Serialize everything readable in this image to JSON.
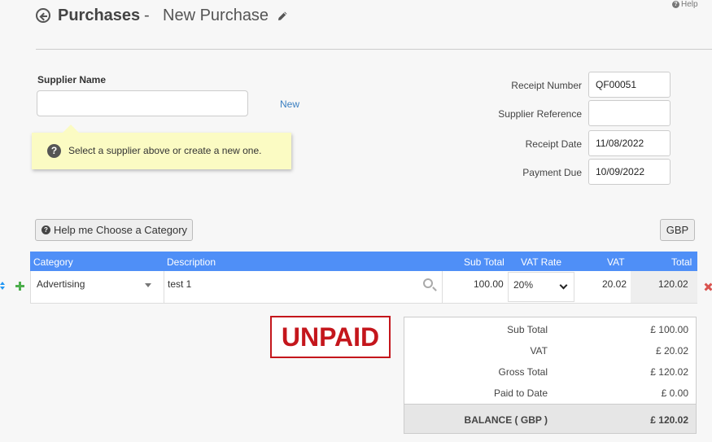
{
  "header": {
    "title": "Purchases",
    "separator": "-",
    "subtitle": "New Purchase",
    "help": "Help"
  },
  "supplier": {
    "label": "Supplier Name",
    "value": "",
    "new_link": "New",
    "tip": "Select a supplier above or create a new one."
  },
  "form": {
    "receipt_number_label": "Receipt Number",
    "receipt_number": "QF00051",
    "supplier_reference_label": "Supplier Reference",
    "supplier_reference": "",
    "receipt_date_label": "Receipt Date",
    "receipt_date": "11/08/2022",
    "payment_due_label": "Payment Due",
    "payment_due": "10/09/2022"
  },
  "buttons": {
    "help_category": "Help me Choose a Category",
    "currency": "GBP"
  },
  "table": {
    "headers": {
      "category": "Category",
      "description": "Description",
      "sub_total": "Sub Total",
      "vat_rate": "VAT Rate",
      "vat": "VAT",
      "total": "Total"
    },
    "rows": [
      {
        "category": "Advertising",
        "description": "test 1",
        "sub_total": "100.00",
        "vat_rate": "20%",
        "vat": "20.02",
        "total": "120.02"
      }
    ]
  },
  "status": "UNPAID",
  "totals": {
    "sub_total_label": "Sub Total",
    "sub_total": "£  100.00",
    "vat_label": "VAT",
    "vat": "£  20.02",
    "gross_total_label": "Gross Total",
    "gross_total": "£  120.02",
    "paid_label": "Paid to Date",
    "paid": "£  0.00",
    "balance_label": "BALANCE ( GBP )",
    "balance": "£  120.02"
  },
  "colors": {
    "table_header": "#4f8ff7",
    "status_red": "#c4161c",
    "link_blue": "#3a7fc1",
    "tip_bg": "#fbfbc3"
  }
}
